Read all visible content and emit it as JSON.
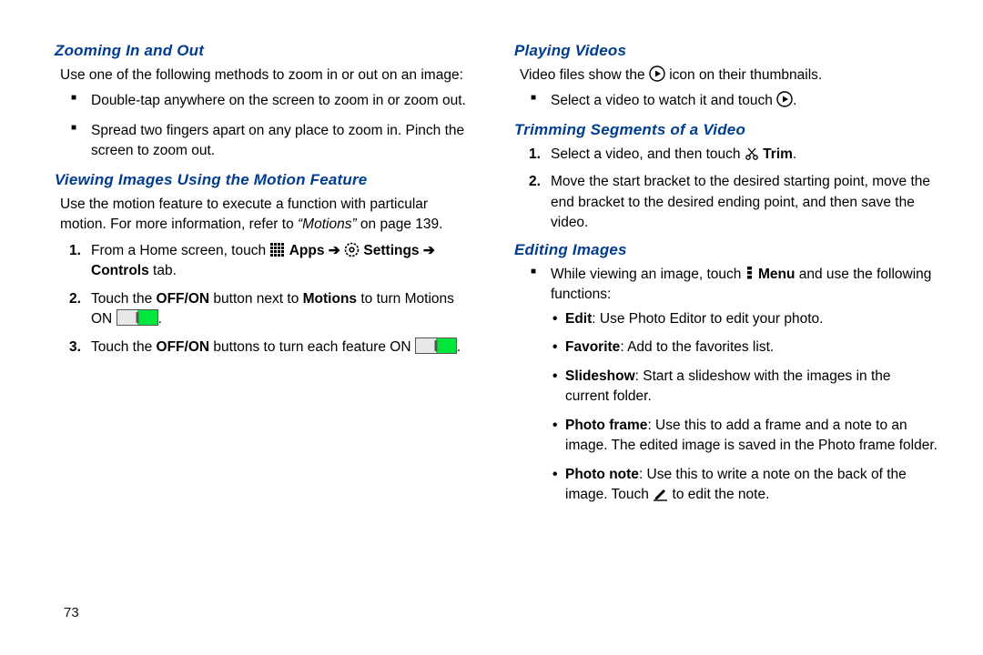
{
  "page_number": "73",
  "left": {
    "h1": "Zooming In and Out",
    "p1": "Use one of the following methods to zoom in or out on an image:",
    "b1": "Double-tap anywhere on the screen to zoom in or zoom out.",
    "b2": "Spread two fingers apart on any place to zoom in. Pinch the screen to zoom out.",
    "h2": "Viewing Images Using the Motion Feature",
    "p2a": "Use the motion feature to execute a function with particular motion. For more information, refer to ",
    "p2b": "“Motions”",
    "p2c": " on page 139.",
    "s1a": "From a Home screen, touch ",
    "s1_apps": "Apps",
    "s1_arrow": " ➔ ",
    "s1_settings": "Settings",
    "s1_arrow2": " ➔ ",
    "s1_controls": "Controls",
    "s1_tab": " tab.",
    "s2a": "Touch the ",
    "s2b": "OFF/ON",
    "s2c": " button next to ",
    "s2d": "Motions",
    "s2e": " to turn Motions ON ",
    "s2f": ".",
    "s3a": "Touch the ",
    "s3b": "OFF/ON",
    "s3c": " buttons to turn each feature ON ",
    "s3d": "."
  },
  "right": {
    "h1": "Playing Videos",
    "p1a": "Video files show the ",
    "p1b": " icon on their thumbnails.",
    "b1a": "Select a video to watch it and touch ",
    "b1b": ".",
    "h2": "Trimming Segments of a Video",
    "t1a": "Select a video, and then touch ",
    "t1_trim": "Trim",
    "t1b": ".",
    "t2": "Move the start bracket to the desired starting point, move the end bracket to the desired ending point, and then save the video.",
    "h3": "Editing Images",
    "e1a": "While viewing an image, touch ",
    "e1_menu": "Menu",
    "e1b": " and use the following functions:",
    "d1a": "Edit",
    "d1b": ": Use Photo Editor to edit your photo.",
    "d2a": "Favorite",
    "d2b": ": Add to the favorites list.",
    "d3a": "Slideshow",
    "d3b": ": Start a slideshow with the images in the current folder.",
    "d4a": "Photo frame",
    "d4b": ": Use this to add a frame and a note to an image. The edited image is saved in the Photo frame folder.",
    "d5a": "Photo note",
    "d5b": ": Use this to write a note on the back of the image. Touch ",
    "d5c": " to edit the note."
  }
}
